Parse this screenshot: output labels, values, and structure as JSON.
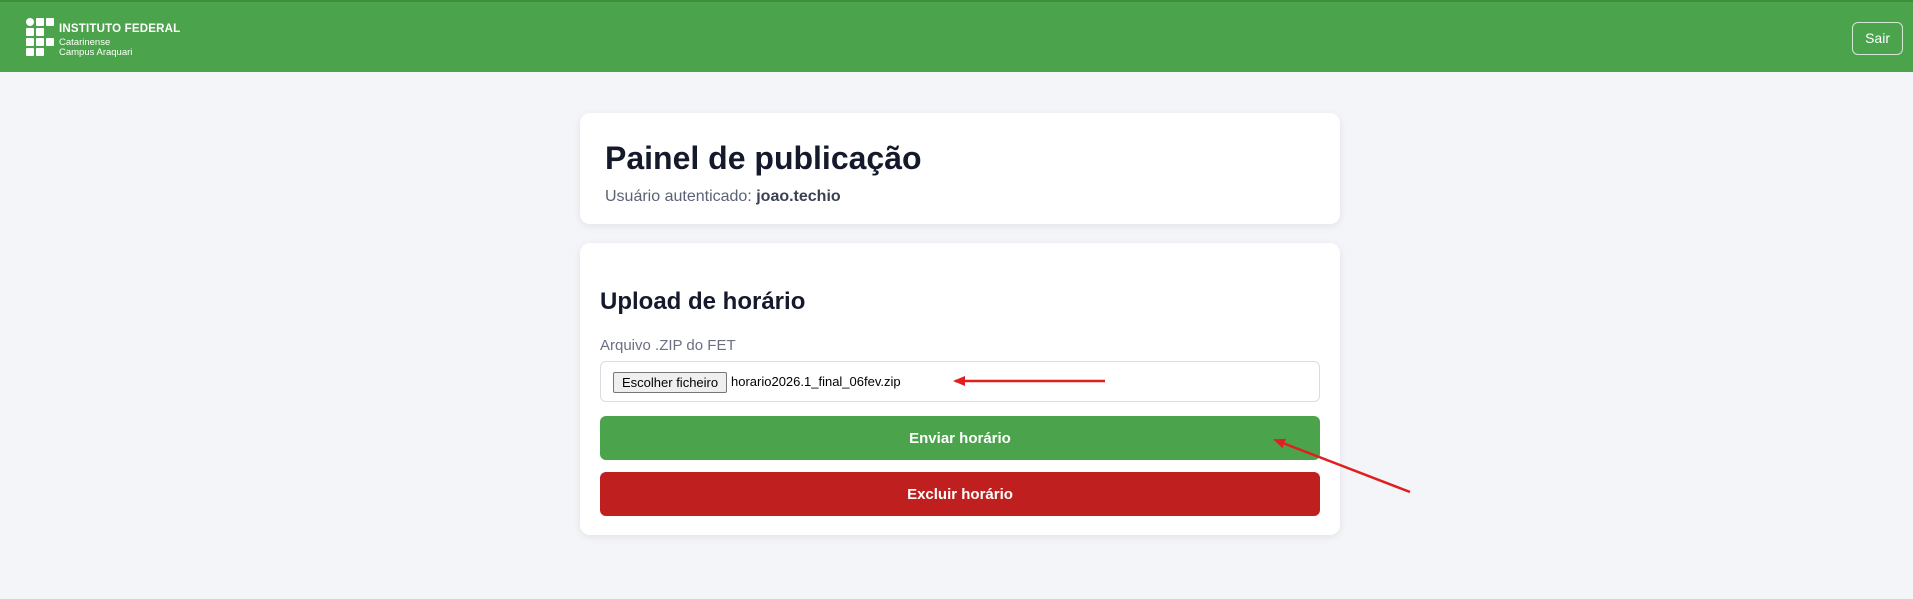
{
  "header": {
    "logo": {
      "title": "INSTITUTO FEDERAL",
      "subtitle1": "Catarinense",
      "subtitle2": "Campus Araquari"
    },
    "logout_label": "Sair",
    "bg_color": "#4ba34b"
  },
  "panel": {
    "title": "Painel de publicação",
    "user_label": "Usuário autenticado:",
    "username": "joao.techio"
  },
  "upload": {
    "title": "Upload de horário",
    "file_label": "Arquivo .ZIP do FET",
    "choose_file_label": "Escolher ficheiro",
    "file_name": "horario2026.1_final_06fev.zip",
    "send_label": "Enviar horário",
    "delete_label": "Excluir horário",
    "send_color": "#4ba34b",
    "delete_color": "#c01f1f"
  },
  "annotations": {
    "arrow_color": "#e02020",
    "arrows": [
      "arrow-to-file-name",
      "arrow-to-send-button"
    ]
  }
}
